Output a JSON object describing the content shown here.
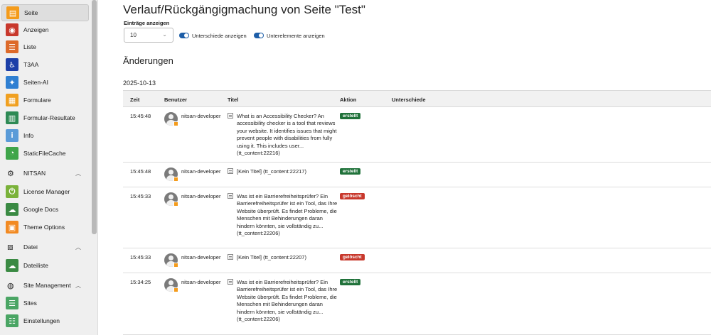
{
  "sidebar": {
    "items": [
      {
        "label": "Seite",
        "icon": "page-icon",
        "color": "#f49b1b",
        "active": true
      },
      {
        "label": "Anzeigen",
        "icon": "eye-icon",
        "color": "#c8382c"
      },
      {
        "label": "Liste",
        "icon": "list-icon",
        "color": "#dd6a2a"
      },
      {
        "label": "T3AA",
        "icon": "accessibility-icon",
        "color": "#1c3fa8"
      },
      {
        "label": "Seiten-AI",
        "icon": "ai-sparkle-icon",
        "color": "#2f7fd2"
      },
      {
        "label": "Formulare",
        "icon": "form-icon",
        "color": "#f0a020"
      },
      {
        "label": "Formular-Resultate",
        "icon": "form-results-icon",
        "color": "#2e8a55"
      },
      {
        "label": "Info",
        "icon": "info-icon",
        "color": "#5a9bd8"
      },
      {
        "label": "StaticFileCache",
        "icon": "cache-icon",
        "color": "#3fa54a"
      }
    ],
    "group_nitsan": {
      "label": "NITSAN",
      "icon": "gear-icon"
    },
    "nitsan_items": [
      {
        "label": "License Manager",
        "icon": "license-icon",
        "color": "#7ab23a"
      },
      {
        "label": "Google Docs",
        "icon": "google-docs-icon",
        "color": "#3a8a43"
      },
      {
        "label": "Theme Options",
        "icon": "theme-options-icon",
        "color": "#f28a22"
      }
    ],
    "group_datei": {
      "label": "Datei",
      "icon": "image-icon"
    },
    "datei_items": [
      {
        "label": "Dateiliste",
        "icon": "file-list-icon",
        "color": "#3a8a43"
      }
    ],
    "group_site": {
      "label": "Site Management",
      "icon": "globe-icon"
    },
    "site_items": [
      {
        "label": "Sites",
        "icon": "sites-icon",
        "color": "#4aa564"
      },
      {
        "label": "Einstellungen",
        "icon": "settings-icon",
        "color": "#4aa564"
      }
    ]
  },
  "main": {
    "title": "Verlauf/Rückgängigmachung von Seite \"Test\"",
    "entries_label": "Einträge anzeigen",
    "entries_value": "10",
    "toggle_diff": "Unterschiede anzeigen",
    "toggle_sub": "Unterelemente anzeigen",
    "changes_title": "Änderungen",
    "date": "2025-10-13",
    "columns": {
      "time": "Zeit",
      "user": "Benutzer",
      "title": "Titel",
      "action": "Aktion",
      "diff": "Unterschiede"
    },
    "rows": [
      {
        "time": "15:45:48",
        "user": "nitsan-developer",
        "title": "What is an Accessibility Checker? An accessibility checker is a tool that reviews your website. It identifies issues that might prevent people with disabilities from fully using it. This includes user... (tt_content:22216)",
        "action": "erstellt",
        "kind": "created"
      },
      {
        "time": "15:45:48",
        "user": "nitsan-developer",
        "title": "[Kein Titel] (tt_content:22217)",
        "action": "erstellt",
        "kind": "created"
      },
      {
        "time": "15:45:33",
        "user": "nitsan-developer",
        "title": "Was ist ein Barrierefreiheitsprüfer? Ein Barrierefreiheitsprüfer ist ein Tool, das Ihre Website überprüft. Es findet Probleme, die Menschen mit Behinderungen daran hindern könnten, sie vollständig zu... (tt_content:22206)",
        "action": "gelöscht",
        "kind": "deleted"
      },
      {
        "time": "15:45:33",
        "user": "nitsan-developer",
        "title": "[Kein Titel] (tt_content:22207)",
        "action": "gelöscht",
        "kind": "deleted"
      },
      {
        "time": "15:34:25",
        "user": "nitsan-developer",
        "title": "Was ist ein Barrierefreiheitsprüfer? Ein Barrierefreiheitsprüfer ist ein Tool, das Ihre Website überprüft. Es findet Probleme, die Menschen mit Behinderungen daran hindern könnten, sie vollständig zu... (tt_content:22206)",
        "action": "erstellt",
        "kind": "created"
      }
    ]
  }
}
